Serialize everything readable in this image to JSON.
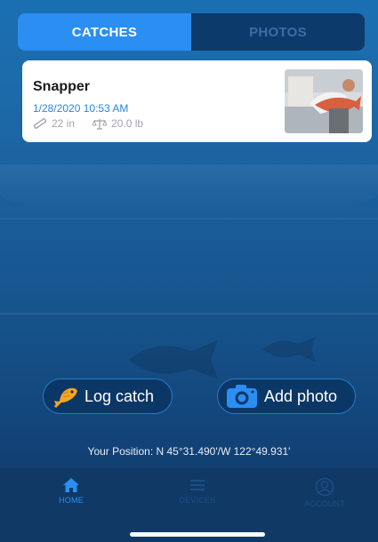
{
  "tabs": [
    {
      "label": "CATCHES",
      "active": true
    },
    {
      "label": "PHOTOS",
      "active": false
    }
  ],
  "catch_card": {
    "species": "Snapper",
    "datetime": "1/28/2020 10:53 AM",
    "length": "22 in",
    "weight": "20.0 lb",
    "length_icon": "ruler-icon",
    "weight_icon": "scale-icon"
  },
  "actions": {
    "log_catch": "Log catch",
    "add_photo": "Add photo"
  },
  "position": "Your Position: N 45°31.490'/W 122°49.931'",
  "nav": {
    "home": "HOME",
    "devices": "DEVICES",
    "account": "ACCOUNT"
  },
  "colors": {
    "accent": "#2b8ef2",
    "nav_bg": "#103966",
    "inactive_nav": "#1e4d83",
    "fish_icon": "#f5a623"
  }
}
